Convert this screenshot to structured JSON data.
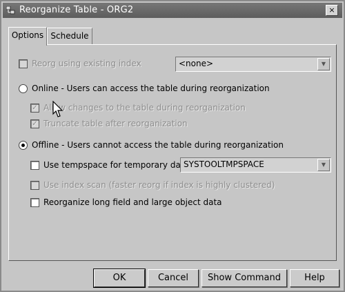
{
  "window": {
    "title": "Reorganize Table - ORG2",
    "close_label": "×"
  },
  "tabs": [
    {
      "label": "Options"
    },
    {
      "label": "Schedule"
    }
  ],
  "options": {
    "reorg_index_label": "Reorg using existing index",
    "index_select_value": "<none>",
    "online_label": "Online - Users can access the table during reorganization",
    "allow_changes_label": "Allow changes to the table during reorganization",
    "truncate_label": "Truncate table after reorganization",
    "offline_label": "Offline - Users cannot access the table during reorganization",
    "tempspace_label": "Use tempspace for temporary data",
    "tempspace_value": "SYSTOOLTMPSPACE",
    "index_scan_label": "Use index scan (faster reorg if index is highly clustered)",
    "long_field_label": "Reorganize long field and large object data"
  },
  "buttons": {
    "ok": "OK",
    "cancel": "Cancel",
    "show_command": "Show Command",
    "help": "Help"
  }
}
